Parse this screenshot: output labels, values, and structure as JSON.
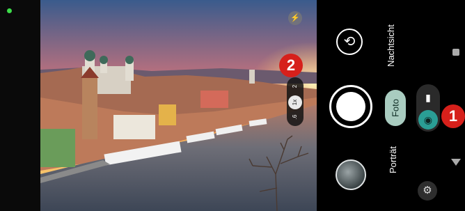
{
  "status": {
    "camera_indicator_color": "#3ddc4a"
  },
  "viewfinder": {
    "flash_icon": "flash-off-icon",
    "zoom_options": {
      "wide": ".6",
      "normal": "1x",
      "tele": "2"
    }
  },
  "annotations": {
    "badge1": "1",
    "badge2": "2"
  },
  "controls": {
    "switch_camera_icon": "rotate-camera-icon",
    "modes": {
      "night": "Nachtsicht",
      "photo": "Foto",
      "portrait": "Porträt"
    },
    "lens_toggle": {
      "photo_icon": "camera-icon",
      "video_icon": "video-icon"
    },
    "settings_icon": "settings-gear-icon"
  },
  "colors": {
    "accent_mode": "#a9ccc0",
    "accent_toggle": "#2a9e95",
    "badge": "#d6201b"
  }
}
